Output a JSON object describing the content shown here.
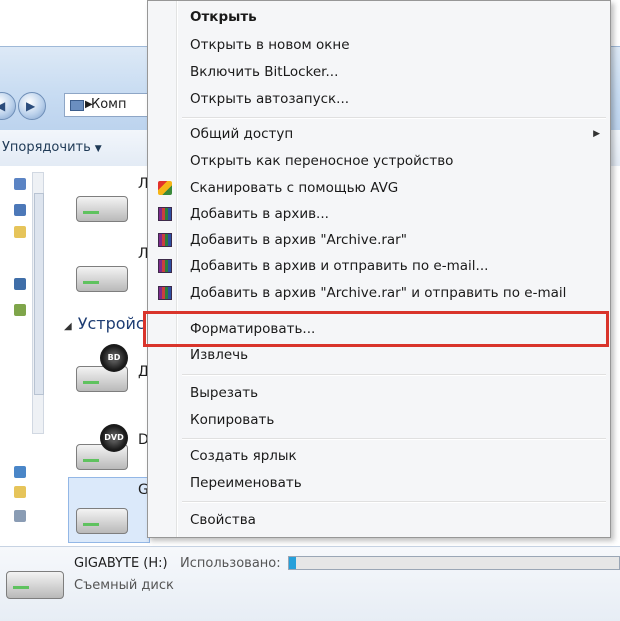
{
  "explorer": {
    "address_text": "Комп",
    "toolbar": {
      "organize_label": "Упорядочить"
    },
    "group_header": "Устройс",
    "drives": [
      {
        "label": "Л"
      },
      {
        "label": "Л"
      },
      {
        "label": "Д",
        "badge": "BD"
      },
      {
        "label": "D",
        "badge": "DVD"
      },
      {
        "label": "G"
      }
    ],
    "details": {
      "name": "GIGABYTE (H:)",
      "used_label": "Использовано:",
      "type": "Съемный диск",
      "usage_fraction": 0.02
    }
  },
  "context_menu": {
    "items": [
      {
        "label": "Открыть",
        "bold": true
      },
      {
        "label": "Открыть в новом окне"
      },
      {
        "label": "Включить BitLocker..."
      },
      {
        "label": "Открыть автозапуск..."
      },
      {
        "label": "Общий доступ",
        "submenu": true
      },
      {
        "label": "Открыть как переносное устройство"
      },
      {
        "label": "Сканировать с помощью AVG",
        "icon": "avg-icon"
      },
      {
        "label": "Добавить в архив...",
        "icon": "winrar-icon"
      },
      {
        "label": "Добавить в архив \"Archive.rar\"",
        "icon": "winrar-icon"
      },
      {
        "label": "Добавить в архив и отправить по e-mail...",
        "icon": "winrar-icon"
      },
      {
        "label": "Добавить в архив \"Archive.rar\" и отправить по e-mail",
        "icon": "winrar-icon"
      },
      {
        "label": "Форматировать...",
        "highlighted": true
      },
      {
        "label": "Извлечь"
      },
      {
        "label": "Вырезать"
      },
      {
        "label": "Копировать"
      },
      {
        "label": "Создать ярлык"
      },
      {
        "label": "Переименовать"
      },
      {
        "label": "Свойства"
      }
    ]
  },
  "colors": {
    "highlight_border": "#d9342b",
    "progress_fill": "#26a0da",
    "menu_background": "#f5f6f8"
  }
}
